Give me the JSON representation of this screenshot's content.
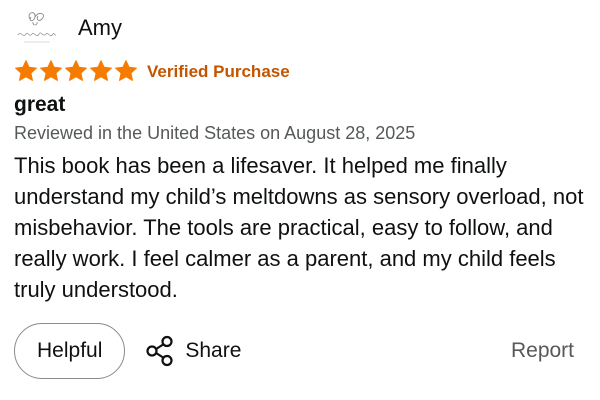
{
  "review": {
    "author": "Amy",
    "avatar_icon": "script-logo-avatar-icon",
    "rating": 5,
    "rating_max": 5,
    "star_color": "#f57c00",
    "verified_label": "Verified Purchase",
    "verified_color": "#c45500",
    "title": "great",
    "meta": "Reviewed in the United States on August 28, 2025",
    "body": "This book has been a lifesaver. It helped me finally understand my child’s meltdowns as sensory overload, not misbehavior. The tools are practical, easy to follow, and really work. I feel calmer as a parent, and my child feels truly understood."
  },
  "actions": {
    "helpful_label": "Helpful",
    "share_label": "Share",
    "share_icon": "share-icon",
    "report_label": "Report"
  }
}
